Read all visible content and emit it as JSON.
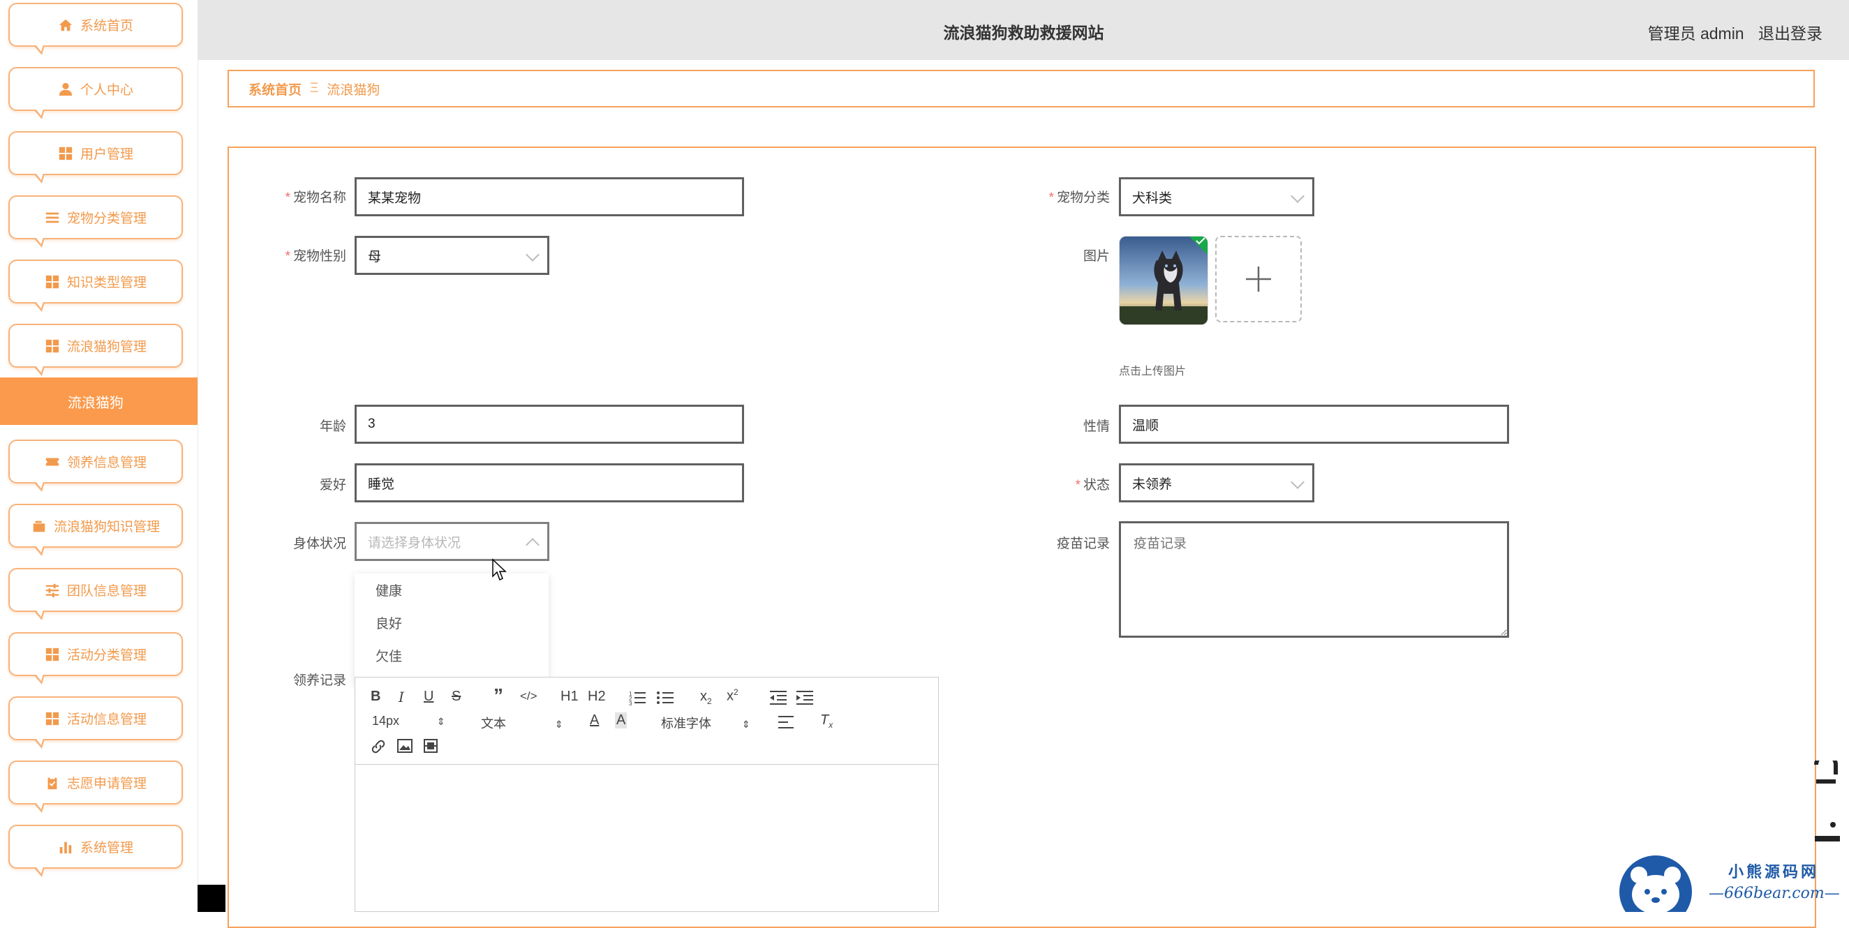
{
  "sidebar": {
    "items": [
      {
        "label": "系统首页",
        "icon": "home-icon"
      },
      {
        "label": "个人中心",
        "icon": "user-icon"
      },
      {
        "label": "用户管理",
        "icon": "grid-icon"
      },
      {
        "label": "宠物分类管理",
        "icon": "list-icon"
      },
      {
        "label": "知识类型管理",
        "icon": "grid-icon"
      },
      {
        "label": "流浪猫狗管理",
        "icon": "grid-icon"
      },
      {
        "label": "领养信息管理",
        "icon": "ticket-icon"
      },
      {
        "label": "流浪猫狗知识管理",
        "icon": "wallet-icon"
      },
      {
        "label": "团队信息管理",
        "icon": "sliders-icon"
      },
      {
        "label": "活动分类管理",
        "icon": "grid-icon"
      },
      {
        "label": "活动信息管理",
        "icon": "grid-icon"
      },
      {
        "label": "志愿申请管理",
        "icon": "clipboard-icon"
      },
      {
        "label": "系统管理",
        "icon": "bar-chart-icon"
      }
    ],
    "active_sub": "流浪猫狗"
  },
  "header": {
    "title": "流浪猫狗救助救援网站",
    "user_label": "管理员 admin",
    "logout_label": "退出登录"
  },
  "breadcrumb": {
    "home": "系统首页",
    "separator": "Ξ",
    "current": "流浪猫狗"
  },
  "form": {
    "pet_name": {
      "label": "宠物名称",
      "value": "某某宠物",
      "required": true
    },
    "pet_category": {
      "label": "宠物分类",
      "value": "犬科类",
      "required": true
    },
    "pet_gender": {
      "label": "宠物性别",
      "value": "母",
      "required": true
    },
    "image": {
      "label": "图片",
      "tip": "点击上传图片"
    },
    "age": {
      "label": "年龄",
      "value": "3"
    },
    "temperament": {
      "label": "性情",
      "value": "温顺"
    },
    "hobby": {
      "label": "爱好",
      "value": "睡觉"
    },
    "status": {
      "label": "状态",
      "value": "未领养",
      "required": true
    },
    "body_condition": {
      "label": "身体状况",
      "placeholder": "请选择身体状况",
      "options": [
        "健康",
        "良好",
        "欠佳"
      ]
    },
    "vaccine_record": {
      "label": "疫苗记录",
      "placeholder": "疫苗记录"
    },
    "adoption_record": {
      "label": "领养记录"
    }
  },
  "editor": {
    "font_size": "14px",
    "paragraph": "文本",
    "font_family": "标准字体",
    "heading1": "H1",
    "heading2": "H2"
  },
  "watermark": {
    "title": "小熊源码网",
    "url": "—666bear.com—"
  },
  "colors": {
    "accent": "#fb9a4c",
    "accent_border": "#f7a15c",
    "header_bg": "#e6e6e6",
    "required": "#f56c6c"
  }
}
